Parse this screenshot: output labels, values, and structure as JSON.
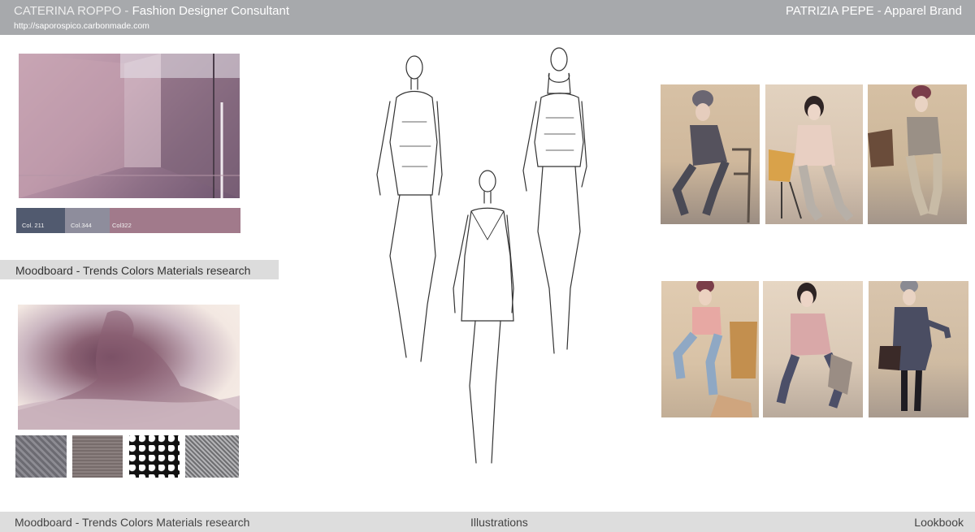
{
  "header": {
    "designer_name": "CATERINA ROPPO",
    "separator": " - ",
    "designer_role": "Fashion Designer Consultant",
    "url": "http://saporospico.carbonmade.com",
    "brand": "PATRIZIA PEPE - Apparel Brand"
  },
  "moodboard": {
    "swatches": [
      "Col. 211",
      "Col.344",
      "Col322"
    ],
    "swatch_colors": [
      "#515a6f",
      "#8e8d9c",
      "#a17a8b"
    ],
    "label": "Moodboard - Trends Colors Materials  research"
  },
  "footer": {
    "moodboard": "Moodboard - Trends Colors Materials  research",
    "illustrations": "Illustrations",
    "lookbook": "Lookbook"
  }
}
